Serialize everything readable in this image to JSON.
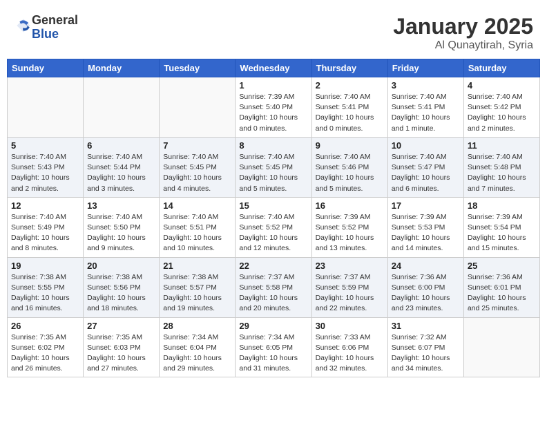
{
  "header": {
    "logo_general": "General",
    "logo_blue": "Blue",
    "month": "January 2025",
    "location": "Al Qunaytirah, Syria"
  },
  "weekdays": [
    "Sunday",
    "Monday",
    "Tuesday",
    "Wednesday",
    "Thursday",
    "Friday",
    "Saturday"
  ],
  "weeks": [
    [
      {
        "day": "",
        "info": ""
      },
      {
        "day": "",
        "info": ""
      },
      {
        "day": "",
        "info": ""
      },
      {
        "day": "1",
        "info": "Sunrise: 7:39 AM\nSunset: 5:40 PM\nDaylight: 10 hours\nand 0 minutes."
      },
      {
        "day": "2",
        "info": "Sunrise: 7:40 AM\nSunset: 5:41 PM\nDaylight: 10 hours\nand 0 minutes."
      },
      {
        "day": "3",
        "info": "Sunrise: 7:40 AM\nSunset: 5:41 PM\nDaylight: 10 hours\nand 1 minute."
      },
      {
        "day": "4",
        "info": "Sunrise: 7:40 AM\nSunset: 5:42 PM\nDaylight: 10 hours\nand 2 minutes."
      }
    ],
    [
      {
        "day": "5",
        "info": "Sunrise: 7:40 AM\nSunset: 5:43 PM\nDaylight: 10 hours\nand 2 minutes."
      },
      {
        "day": "6",
        "info": "Sunrise: 7:40 AM\nSunset: 5:44 PM\nDaylight: 10 hours\nand 3 minutes."
      },
      {
        "day": "7",
        "info": "Sunrise: 7:40 AM\nSunset: 5:45 PM\nDaylight: 10 hours\nand 4 minutes."
      },
      {
        "day": "8",
        "info": "Sunrise: 7:40 AM\nSunset: 5:45 PM\nDaylight: 10 hours\nand 5 minutes."
      },
      {
        "day": "9",
        "info": "Sunrise: 7:40 AM\nSunset: 5:46 PM\nDaylight: 10 hours\nand 5 minutes."
      },
      {
        "day": "10",
        "info": "Sunrise: 7:40 AM\nSunset: 5:47 PM\nDaylight: 10 hours\nand 6 minutes."
      },
      {
        "day": "11",
        "info": "Sunrise: 7:40 AM\nSunset: 5:48 PM\nDaylight: 10 hours\nand 7 minutes."
      }
    ],
    [
      {
        "day": "12",
        "info": "Sunrise: 7:40 AM\nSunset: 5:49 PM\nDaylight: 10 hours\nand 8 minutes."
      },
      {
        "day": "13",
        "info": "Sunrise: 7:40 AM\nSunset: 5:50 PM\nDaylight: 10 hours\nand 9 minutes."
      },
      {
        "day": "14",
        "info": "Sunrise: 7:40 AM\nSunset: 5:51 PM\nDaylight: 10 hours\nand 10 minutes."
      },
      {
        "day": "15",
        "info": "Sunrise: 7:40 AM\nSunset: 5:52 PM\nDaylight: 10 hours\nand 12 minutes."
      },
      {
        "day": "16",
        "info": "Sunrise: 7:39 AM\nSunset: 5:52 PM\nDaylight: 10 hours\nand 13 minutes."
      },
      {
        "day": "17",
        "info": "Sunrise: 7:39 AM\nSunset: 5:53 PM\nDaylight: 10 hours\nand 14 minutes."
      },
      {
        "day": "18",
        "info": "Sunrise: 7:39 AM\nSunset: 5:54 PM\nDaylight: 10 hours\nand 15 minutes."
      }
    ],
    [
      {
        "day": "19",
        "info": "Sunrise: 7:38 AM\nSunset: 5:55 PM\nDaylight: 10 hours\nand 16 minutes."
      },
      {
        "day": "20",
        "info": "Sunrise: 7:38 AM\nSunset: 5:56 PM\nDaylight: 10 hours\nand 18 minutes."
      },
      {
        "day": "21",
        "info": "Sunrise: 7:38 AM\nSunset: 5:57 PM\nDaylight: 10 hours\nand 19 minutes."
      },
      {
        "day": "22",
        "info": "Sunrise: 7:37 AM\nSunset: 5:58 PM\nDaylight: 10 hours\nand 20 minutes."
      },
      {
        "day": "23",
        "info": "Sunrise: 7:37 AM\nSunset: 5:59 PM\nDaylight: 10 hours\nand 22 minutes."
      },
      {
        "day": "24",
        "info": "Sunrise: 7:36 AM\nSunset: 6:00 PM\nDaylight: 10 hours\nand 23 minutes."
      },
      {
        "day": "25",
        "info": "Sunrise: 7:36 AM\nSunset: 6:01 PM\nDaylight: 10 hours\nand 25 minutes."
      }
    ],
    [
      {
        "day": "26",
        "info": "Sunrise: 7:35 AM\nSunset: 6:02 PM\nDaylight: 10 hours\nand 26 minutes."
      },
      {
        "day": "27",
        "info": "Sunrise: 7:35 AM\nSunset: 6:03 PM\nDaylight: 10 hours\nand 27 minutes."
      },
      {
        "day": "28",
        "info": "Sunrise: 7:34 AM\nSunset: 6:04 PM\nDaylight: 10 hours\nand 29 minutes."
      },
      {
        "day": "29",
        "info": "Sunrise: 7:34 AM\nSunset: 6:05 PM\nDaylight: 10 hours\nand 31 minutes."
      },
      {
        "day": "30",
        "info": "Sunrise: 7:33 AM\nSunset: 6:06 PM\nDaylight: 10 hours\nand 32 minutes."
      },
      {
        "day": "31",
        "info": "Sunrise: 7:32 AM\nSunset: 6:07 PM\nDaylight: 10 hours\nand 34 minutes."
      },
      {
        "day": "",
        "info": ""
      }
    ]
  ]
}
